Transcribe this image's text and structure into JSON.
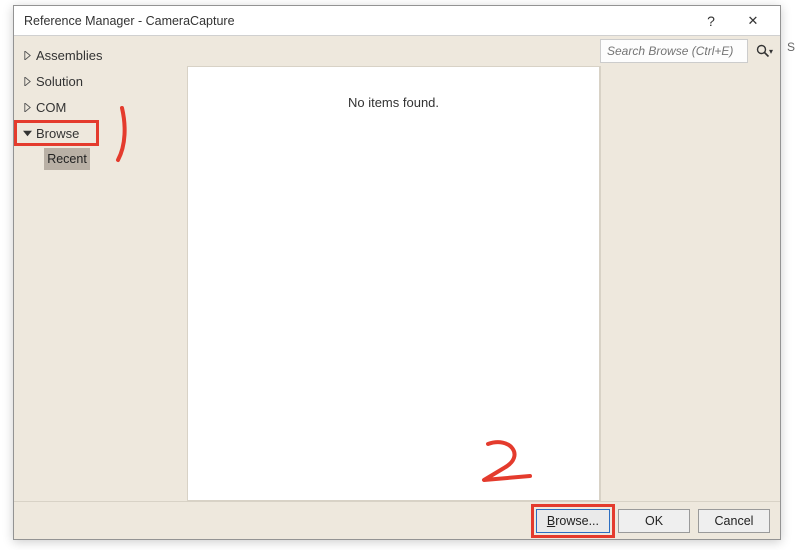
{
  "titlebar": {
    "title": "Reference Manager - CameraCapture",
    "help_glyph": "?",
    "close_glyph": "✕"
  },
  "sidebar": {
    "items": [
      {
        "label": "Assemblies",
        "expanded": false
      },
      {
        "label": "Solution",
        "expanded": false
      },
      {
        "label": "COM",
        "expanded": false
      },
      {
        "label": "Browse",
        "expanded": true
      }
    ],
    "browse_children": [
      {
        "label": "Recent",
        "selected": true
      }
    ]
  },
  "search": {
    "placeholder": "Search Browse (Ctrl+E)",
    "value": ""
  },
  "main": {
    "empty_text": "No items found."
  },
  "footer": {
    "browse_prefix": "B",
    "browse_rest": "rowse...",
    "ok": "OK",
    "cancel": "Cancel"
  },
  "annotations": {
    "mark1": "1  (approx.)",
    "mark2": "2"
  }
}
